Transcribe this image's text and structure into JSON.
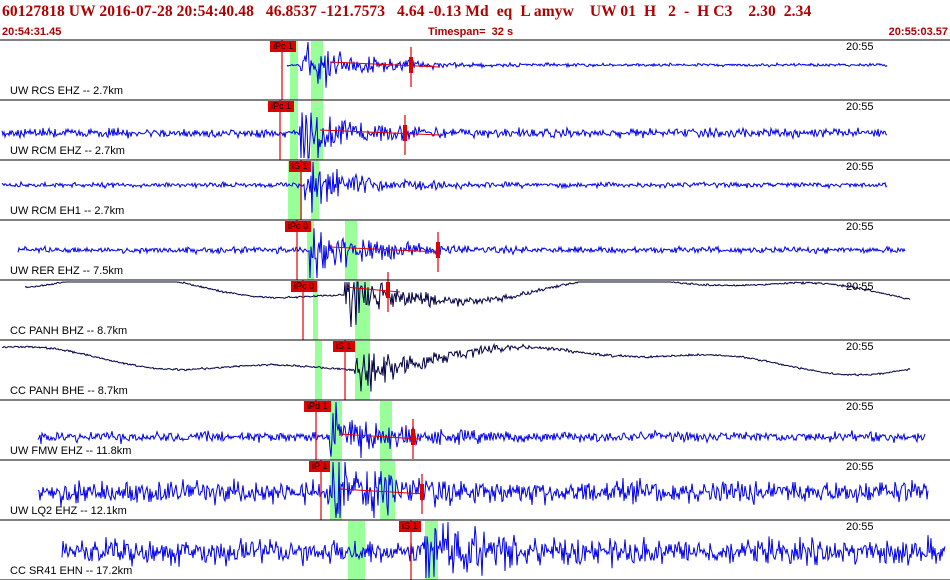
{
  "header": {
    "title": "60127818 UW 2016-07-28 20:54:40.48   46.8537 -121.7573   4.64 -0.13 Md  eq  L amyw    UW 01  H   2  -  H C3    2.30  2.34",
    "start_time": "20:54:31.45",
    "timespan": "Timespan=  32 s",
    "end_time": "20:55:03.57"
  },
  "colors": {
    "header_text": "#b00000",
    "trace_blue": "#0000ee",
    "trace_dark": "#000044",
    "pick_red": "#e00000",
    "window_green": "#99ff99",
    "divider": "#000000"
  },
  "panels": [
    {
      "station": "UW RCS EHZ -- 2.7km",
      "time_label": "20:55",
      "pick_label": "iPc 1",
      "trace": "blue"
    },
    {
      "station": "UW RCM EHZ -- 2.7km",
      "time_label": "20:55",
      "pick_label": "iPc 1",
      "trace": "blue"
    },
    {
      "station": "UW RCM EH1 -- 2.7km",
      "time_label": "20:55",
      "pick_label": "iS 1",
      "trace": "blue"
    },
    {
      "station": "UW RER EHZ -- 7.5km",
      "time_label": "20:55",
      "pick_label": "iPc 0",
      "trace": "blue"
    },
    {
      "station": "CC PANH BHZ -- 8.7km",
      "time_label": "20:55",
      "pick_label": "iPc 0",
      "trace": "dark"
    },
    {
      "station": "CC PANH BHE -- 8.7km",
      "time_label": "20:55",
      "pick_label": "iS 1",
      "trace": "dark"
    },
    {
      "station": "UW FMW EHZ -- 11.8km",
      "time_label": "20:55",
      "pick_label": "iPd 1",
      "trace": "blue"
    },
    {
      "station": "UW LQ2 EHZ -- 12.1km",
      "time_label": "20:55",
      "pick_label": "iP 1",
      "trace": "blue"
    },
    {
      "station": "CC SR41 EHN -- 17.2km",
      "time_label": "20:55",
      "pick_label": "iS 1",
      "trace": "blue"
    }
  ]
}
